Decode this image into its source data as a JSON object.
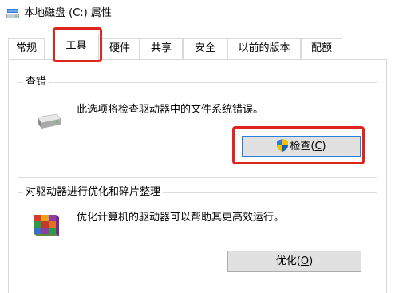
{
  "window": {
    "title": "本地磁盘 (C:) 属性"
  },
  "tabs": [
    {
      "label": "常规"
    },
    {
      "label": "工具",
      "active": true
    },
    {
      "label": "硬件"
    },
    {
      "label": "共享"
    },
    {
      "label": "安全"
    },
    {
      "label": "以前的版本"
    },
    {
      "label": "配额"
    }
  ],
  "error_check": {
    "group_title": "查错",
    "description": "此选项将检查驱动器中的文件系统错误。",
    "button_label": "检查(",
    "button_mnemonic": "C",
    "button_suffix": ")"
  },
  "optimize": {
    "group_title": "对驱动器进行优化和碎片整理",
    "description": "优化计算机的驱动器可以帮助其更高效运行。",
    "button_label": "优化(",
    "button_mnemonic": "O",
    "button_suffix": ")"
  },
  "colors": {
    "highlight_box": "#e0241f",
    "button_focus": "#2a7fd8",
    "button_face": "#e1e1e1"
  },
  "icons": {
    "title": "drive-icon",
    "error_check": "hard-drive-icon",
    "optimize": "defrag-icon",
    "check_button": "uac-shield-icon"
  }
}
